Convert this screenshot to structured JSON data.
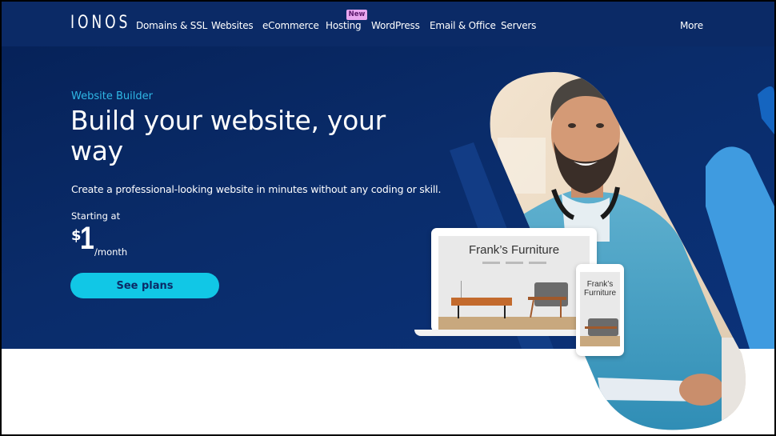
{
  "nav": {
    "logo": "IONOS",
    "items": [
      {
        "label": "Domains & SSL"
      },
      {
        "label": "Websites"
      },
      {
        "label": "eCommerce"
      },
      {
        "label": "Hosting",
        "badge": "New"
      },
      {
        "label": "WordPress"
      },
      {
        "label": "Email & Office"
      },
      {
        "label": "Servers"
      }
    ],
    "more": "More"
  },
  "hero": {
    "eyebrow": "Website Builder",
    "headline": "Build your website, your way",
    "subtitle": "Create a professional-looking website in minutes without any coding or skill.",
    "starting_label": "Starting at",
    "price_currency": "$",
    "price_amount": "1",
    "price_period": "/month",
    "cta": "See plans"
  },
  "mockup": {
    "laptop_title": "Frank’s Furniture",
    "phone_title": "Frank’s Furniture"
  },
  "colors": {
    "nav_bg": "#0b2a66",
    "hero_bg": "#0a2c6a",
    "accent": "#11c7e6",
    "eyebrow": "#2fb8e6",
    "badge": "#e8a7f0"
  }
}
